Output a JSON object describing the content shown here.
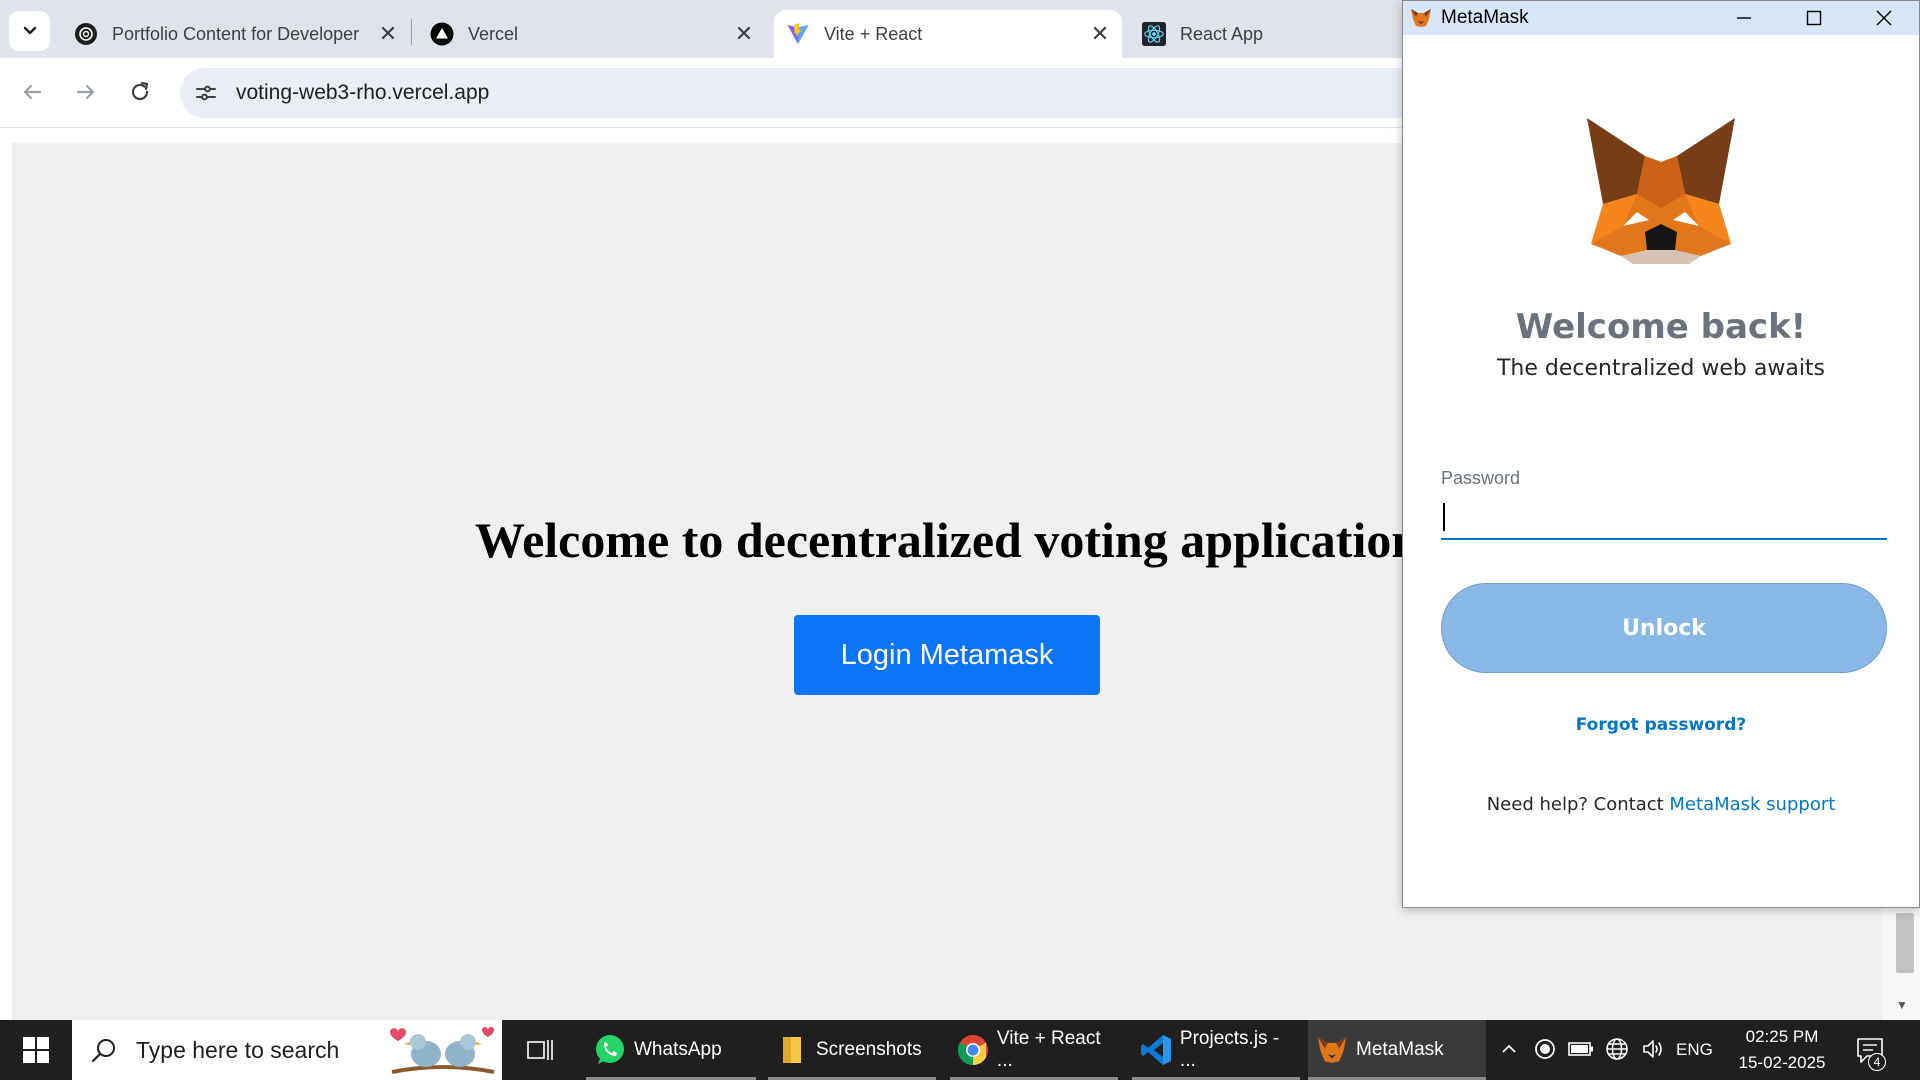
{
  "browser": {
    "tabs": [
      {
        "title": "Portfolio Content for Developer",
        "favicon": "chatgpt-icon",
        "active": false
      },
      {
        "title": "Vercel",
        "favicon": "vercel-icon",
        "active": false
      },
      {
        "title": "Vite + React",
        "favicon": "vite-icon",
        "active": true
      },
      {
        "title": "React App",
        "favicon": "react-icon",
        "active": false
      }
    ],
    "url": "voting-web3-rho.vercel.app"
  },
  "page": {
    "heading": "Welcome to decentralized voting application",
    "login_button": "Login Metamask",
    "background": "#f0f0f0",
    "button_color": "#0b74f7"
  },
  "metamask": {
    "window_title": "MetaMask",
    "welcome": "Welcome back!",
    "tagline": "The decentralized web awaits",
    "password_label": "Password",
    "password_value": "",
    "unlock_label": "Unlock",
    "forgot_label": "Forgot password?",
    "help_prefix": "Need help? Contact ",
    "help_link": "MetaMask support",
    "accent_color": "#0376c9"
  },
  "taskbar": {
    "search_placeholder": "Type here to search",
    "apps": [
      {
        "label": "WhatsApp",
        "icon": "whatsapp-icon"
      },
      {
        "label": "Screenshots",
        "icon": "folder-icon"
      },
      {
        "label": "Vite + React ...",
        "icon": "chrome-icon"
      },
      {
        "label": "Projects.js - ...",
        "icon": "vscode-icon"
      },
      {
        "label": "MetaMask",
        "icon": "metamask-icon"
      }
    ],
    "language": "ENG",
    "time": "02:25 PM",
    "date": "15-02-2025",
    "notification_count": "4"
  }
}
